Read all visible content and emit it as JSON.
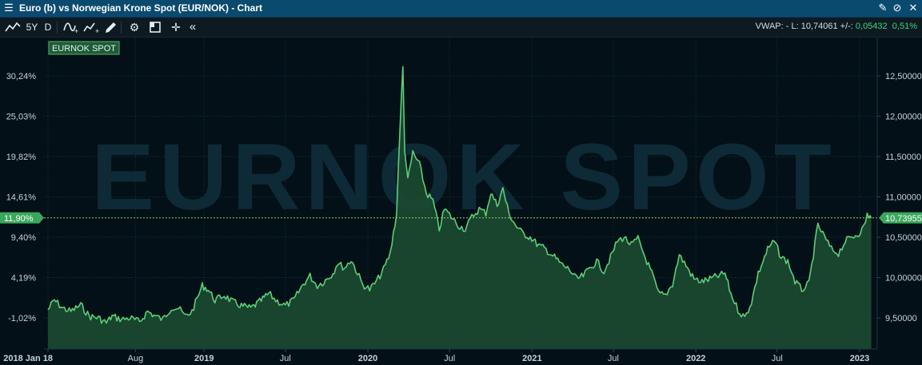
{
  "window": {
    "title": "Euro (b) vs Norwegian Krone Spot (EUR/NOK) - Chart"
  },
  "toolbar": {
    "period": "5Y",
    "interval": "D",
    "vwap_text": "VWAP: -  L: 10,74061  +/-: ",
    "change_abs": "0,05432",
    "change_pct": "0,51%"
  },
  "chart_data": {
    "type": "area",
    "legend": "EURNOK SPOT",
    "watermark": "EURNOK SPOT",
    "x_ticks": [
      "2018 Jan 18",
      "Aug",
      "2019",
      "Jul",
      "2020",
      "Jul",
      "2021",
      "Jul",
      "2022",
      "Jul",
      "2023"
    ],
    "x_tick_dates": [
      "2018-01-18",
      "2018-08-01",
      "2019-01-01",
      "2019-07-01",
      "2020-01-01",
      "2020-07-01",
      "2021-01-01",
      "2021-07-01",
      "2022-01-01",
      "2022-07-01",
      "2023-01-01"
    ],
    "y_right_ticks": [
      "12,50000",
      "12,00000",
      "11,50000",
      "11,00000",
      "10,50000",
      "10,00000",
      "9,50000"
    ],
    "y_right_values": [
      12.5,
      12.0,
      11.5,
      11.0,
      10.5,
      10.0,
      9.5
    ],
    "y_left_ticks": [
      "30,24%",
      "25,03%",
      "19,82%",
      "14,61%",
      "9,40%",
      "4,19%",
      "-1,02%"
    ],
    "last_value_label": "10,73955",
    "last_pct_label": "11,90%",
    "last_value": 10.73955,
    "series": [
      {
        "name": "EURNOK SPOT",
        "color": "#5ccf78",
        "points": [
          [
            "2018-01-18",
            9.6
          ],
          [
            "2018-02-01",
            9.72
          ],
          [
            "2018-02-20",
            9.62
          ],
          [
            "2018-03-10",
            9.58
          ],
          [
            "2018-04-01",
            9.66
          ],
          [
            "2018-04-20",
            9.52
          ],
          [
            "2018-05-10",
            9.5
          ],
          [
            "2018-05-28",
            9.44
          ],
          [
            "2018-06-10",
            9.52
          ],
          [
            "2018-07-01",
            9.48
          ],
          [
            "2018-07-20",
            9.5
          ],
          [
            "2018-08-10",
            9.45
          ],
          [
            "2018-08-28",
            9.58
          ],
          [
            "2018-09-15",
            9.52
          ],
          [
            "2018-10-01",
            9.48
          ],
          [
            "2018-10-20",
            9.63
          ],
          [
            "2018-11-05",
            9.62
          ],
          [
            "2018-11-20",
            9.52
          ],
          [
            "2018-12-05",
            9.58
          ],
          [
            "2018-12-28",
            9.9
          ],
          [
            "2019-01-10",
            9.85
          ],
          [
            "2019-01-25",
            9.72
          ],
          [
            "2019-02-15",
            9.78
          ],
          [
            "2019-03-05",
            9.7
          ],
          [
            "2019-03-25",
            9.65
          ],
          [
            "2019-04-15",
            9.62
          ],
          [
            "2019-05-05",
            9.7
          ],
          [
            "2019-05-25",
            9.8
          ],
          [
            "2019-06-10",
            9.72
          ],
          [
            "2019-07-01",
            9.65
          ],
          [
            "2019-07-20",
            9.72
          ],
          [
            "2019-08-10",
            9.92
          ],
          [
            "2019-08-25",
            10.02
          ],
          [
            "2019-09-10",
            9.9
          ],
          [
            "2019-09-25",
            9.95
          ],
          [
            "2019-10-15",
            10.05
          ],
          [
            "2019-10-25",
            10.18
          ],
          [
            "2019-11-10",
            10.12
          ],
          [
            "2019-11-25",
            10.22
          ],
          [
            "2019-12-05",
            10.1
          ],
          [
            "2019-12-20",
            9.92
          ],
          [
            "2020-01-05",
            9.85
          ],
          [
            "2020-01-20",
            9.95
          ],
          [
            "2020-02-05",
            10.1
          ],
          [
            "2020-02-20",
            10.3
          ],
          [
            "2020-03-05",
            10.8
          ],
          [
            "2020-03-12",
            11.8
          ],
          [
            "2020-03-19",
            12.6
          ],
          [
            "2020-03-23",
            11.6
          ],
          [
            "2020-03-30",
            11.2
          ],
          [
            "2020-04-10",
            11.55
          ],
          [
            "2020-04-25",
            11.4
          ],
          [
            "2020-05-10",
            11.05
          ],
          [
            "2020-05-25",
            10.95
          ],
          [
            "2020-06-08",
            10.6
          ],
          [
            "2020-06-20",
            10.85
          ],
          [
            "2020-07-05",
            10.75
          ],
          [
            "2020-07-20",
            10.65
          ],
          [
            "2020-08-05",
            10.6
          ],
          [
            "2020-08-20",
            10.75
          ],
          [
            "2020-09-05",
            10.85
          ],
          [
            "2020-09-20",
            10.8
          ],
          [
            "2020-10-01",
            11.05
          ],
          [
            "2020-10-15",
            10.9
          ],
          [
            "2020-10-28",
            11.1
          ],
          [
            "2020-11-10",
            10.8
          ],
          [
            "2020-11-25",
            10.65
          ],
          [
            "2020-12-10",
            10.55
          ],
          [
            "2020-12-28",
            10.5
          ],
          [
            "2021-01-15",
            10.4
          ],
          [
            "2021-02-01",
            10.35
          ],
          [
            "2021-02-20",
            10.25
          ],
          [
            "2021-03-10",
            10.15
          ],
          [
            "2021-03-25",
            10.1
          ],
          [
            "2021-04-10",
            9.98
          ],
          [
            "2021-04-25",
            10.02
          ],
          [
            "2021-05-10",
            10.12
          ],
          [
            "2021-05-25",
            10.2
          ],
          [
            "2021-06-10",
            10.08
          ],
          [
            "2021-06-25",
            10.25
          ],
          [
            "2021-07-10",
            10.45
          ],
          [
            "2021-07-25",
            10.5
          ],
          [
            "2021-08-10",
            10.4
          ],
          [
            "2021-08-25",
            10.48
          ],
          [
            "2021-09-10",
            10.25
          ],
          [
            "2021-09-25",
            10.05
          ],
          [
            "2021-10-10",
            9.8
          ],
          [
            "2021-10-25",
            9.78
          ],
          [
            "2021-11-10",
            9.92
          ],
          [
            "2021-11-25",
            10.28
          ],
          [
            "2021-12-10",
            10.15
          ],
          [
            "2021-12-28",
            9.98
          ],
          [
            "2022-01-15",
            9.95
          ],
          [
            "2022-02-01",
            9.98
          ],
          [
            "2022-02-20",
            10.02
          ],
          [
            "2022-03-07",
            10.05
          ],
          [
            "2022-03-20",
            9.8
          ],
          [
            "2022-04-05",
            9.6
          ],
          [
            "2022-04-20",
            9.5
          ],
          [
            "2022-05-05",
            9.7
          ],
          [
            "2022-05-20",
            10.05
          ],
          [
            "2022-06-10",
            10.35
          ],
          [
            "2022-06-25",
            10.45
          ],
          [
            "2022-07-10",
            10.25
          ],
          [
            "2022-07-25",
            10.2
          ],
          [
            "2022-08-10",
            9.95
          ],
          [
            "2022-08-25",
            9.85
          ],
          [
            "2022-09-10",
            9.92
          ],
          [
            "2022-09-30",
            10.65
          ],
          [
            "2022-10-15",
            10.5
          ],
          [
            "2022-10-30",
            10.35
          ],
          [
            "2022-11-15",
            10.3
          ],
          [
            "2022-11-30",
            10.45
          ],
          [
            "2022-12-15",
            10.5
          ],
          [
            "2022-12-30",
            10.55
          ],
          [
            "2023-01-10",
            10.62
          ],
          [
            "2023-01-18",
            10.78
          ],
          [
            "2023-01-27",
            10.74
          ]
        ]
      }
    ]
  }
}
